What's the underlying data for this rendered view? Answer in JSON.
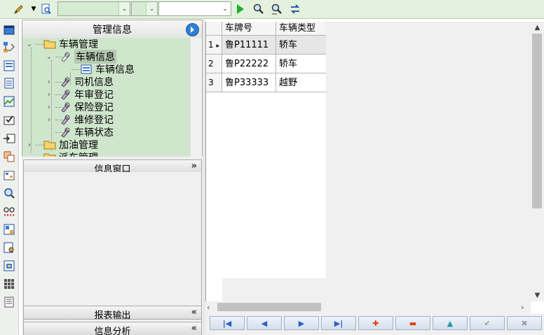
{
  "toolbar": {
    "combo1_value": "",
    "combo2_value": "",
    "combo3_value": "",
    "icons": [
      "pencil-icon",
      "dropdown-caret-icon",
      "preview-icon",
      "run-icon",
      "search-icon",
      "search-filter-icon",
      "refresh-swap-icon"
    ]
  },
  "iconstrip": {
    "icons": [
      "window-icon",
      "tree-link-icon",
      "form-icon",
      "document-icon",
      "chart-icon",
      "checkbox-envelope-icon",
      "export-icon",
      "grid-icon",
      "settings-icon",
      "search-users-icon",
      "binoculars-icon",
      "report-icon",
      "report-view-icon",
      "table-chart-icon",
      "apps-grid-icon",
      "list-icon"
    ]
  },
  "left_panel": {
    "title": "管理信息",
    "tree": [
      {
        "label": "车辆管理",
        "expander": "⌄",
        "icon": "folder-open-icon"
      },
      {
        "label": "车辆信息",
        "expander": "⌄",
        "icon": "tool-icon"
      },
      {
        "label": "车辆信息",
        "expander": "",
        "icon": "form-icon"
      },
      {
        "label": "司机信息",
        "expander": "›",
        "icon": "tool-icon"
      },
      {
        "label": "年审登记",
        "expander": "›",
        "icon": "tool-icon"
      },
      {
        "label": "保险登记",
        "expander": "›",
        "icon": "tool-icon"
      },
      {
        "label": "维修登记",
        "expander": "›",
        "icon": "tool-icon"
      },
      {
        "label": "车辆状态",
        "expander": "",
        "icon": "tool-icon"
      },
      {
        "label": "加油管理",
        "expander": "›",
        "icon": "folder-icon"
      },
      {
        "label": "派车管理",
        "expander": "",
        "icon": "folder-icon"
      }
    ],
    "info_window": {
      "title": "信息窗口",
      "chevron": "»"
    },
    "report_output": {
      "title": "报表输出",
      "chevron": "«"
    },
    "info_analysis": {
      "title": "信息分析",
      "chevron": "«"
    }
  },
  "grid": {
    "columns": [
      "车牌号",
      "车辆类型"
    ],
    "rows": [
      {
        "num": "1",
        "marker": "▸",
        "plate": "鲁P11111",
        "type": "轿车"
      },
      {
        "num": "2",
        "marker": "",
        "plate": "鲁P22222",
        "type": "轿车"
      },
      {
        "num": "3",
        "marker": "",
        "plate": "鲁P33333",
        "type": "越野"
      }
    ]
  },
  "navigator": {
    "buttons": [
      {
        "name": "first",
        "glyph": "|◀",
        "color": "#2b5fc7"
      },
      {
        "name": "prior",
        "glyph": "◀",
        "color": "#2b5fc7"
      },
      {
        "name": "next",
        "glyph": "▶",
        "color": "#2b5fc7"
      },
      {
        "name": "last",
        "glyph": "▶|",
        "color": "#2b5fc7"
      },
      {
        "name": "insert",
        "glyph": "✚",
        "color": "#e0401a"
      },
      {
        "name": "delete",
        "glyph": "▬",
        "color": "#e0401a"
      },
      {
        "name": "edit",
        "glyph": "▲",
        "color": "#1d9aa8"
      },
      {
        "name": "post",
        "glyph": "✔",
        "color": "#9a9a9a"
      },
      {
        "name": "cancel",
        "glyph": "✖",
        "color": "#9a9a9a"
      }
    ]
  }
}
